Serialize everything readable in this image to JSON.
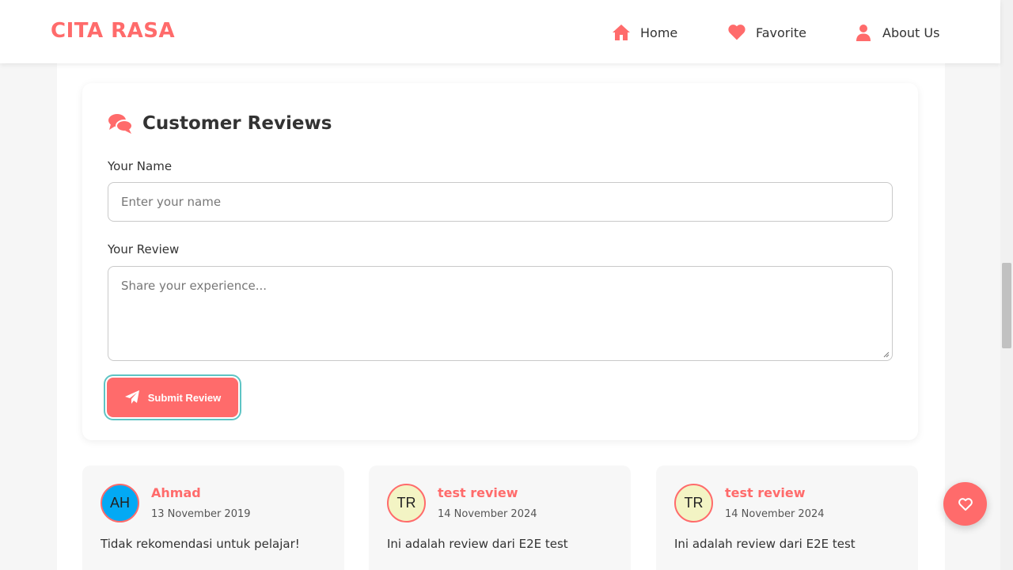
{
  "header": {
    "brand": "CITA RASA",
    "nav": [
      {
        "label": "Home",
        "icon": "home-icon"
      },
      {
        "label": "Favorite",
        "icon": "heart-icon"
      },
      {
        "label": "About Us",
        "icon": "user-icon"
      }
    ]
  },
  "review_form": {
    "title": "Customer Reviews",
    "title_icon": "comments-icon",
    "name_label": "Your Name",
    "name_placeholder": "Enter your name",
    "name_value": "",
    "review_label": "Your Review",
    "review_placeholder": "Share your experience...",
    "review_value": "",
    "submit_label": "Submit Review",
    "submit_icon": "paper-plane-icon"
  },
  "reviews": [
    {
      "initials": "AH",
      "name": "Ahmad",
      "date": "13 November 2019",
      "text": "Tidak rekomendasi untuk pelajar!",
      "avatar_color": "#03a9f4"
    },
    {
      "initials": "TR",
      "name": "test review",
      "date": "14 November 2024",
      "text": "Ini adalah review dari E2E test",
      "avatar_color": "#f3f4c4"
    },
    {
      "initials": "TR",
      "name": "test review",
      "date": "14 November 2024",
      "text": "Ini adalah review dari E2E test",
      "avatar_color": "#f3f4c4"
    }
  ],
  "floating_button": {
    "icon": "heart-outline-icon"
  },
  "colors": {
    "accent": "#ff6b6b",
    "focus_ring": "#5ec4c4",
    "background": "#f6f6f6"
  }
}
